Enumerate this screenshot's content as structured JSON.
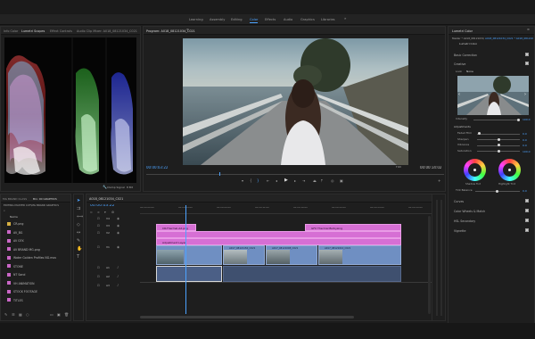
{
  "workspaces": [
    {
      "label": "Learning",
      "active": false
    },
    {
      "label": "Assembly",
      "active": false
    },
    {
      "label": "Editing",
      "active": false
    },
    {
      "label": "Color",
      "active": true
    },
    {
      "label": "Effects",
      "active": false
    },
    {
      "label": "Audio",
      "active": false
    },
    {
      "label": "Graphics",
      "active": false
    },
    {
      "label": "Libraries",
      "active": false
    }
  ],
  "left_panel": {
    "tabs": [
      "Info Color",
      "Lumetri Scopes",
      "Effect Controls",
      "Audio Clip Mixer: A018_08121034_C021"
    ],
    "active_tab": "Lumetri Scopes",
    "clamp_label": "Clamp Signal",
    "bit_label": "8 Bit"
  },
  "program_monitor": {
    "title": "Program: A018_08121034_C021",
    "timecode_left": "00:00:03:22",
    "fit_label": "Full",
    "timecode_right": "00:00:14:02"
  },
  "project_panel": {
    "tabs": [
      "MG BRAND CLASS",
      "Bin: 00 GRAPHICS"
    ],
    "subtitle": "EDITING MASTER CUT\\MG BRAND GRAPHICS",
    "header": "Name",
    "items": [
      {
        "name": "CR.png",
        "color": "#d6b043"
      },
      {
        "name": "AV_BG",
        "color": "#c966c6"
      },
      {
        "name": "AV GFX",
        "color": "#c966c6"
      },
      {
        "name": "AV BRAND MG.png",
        "color": "#c966c6"
      },
      {
        "name": "Water Golden Profiles NG.mov",
        "color": "#c966c6"
      },
      {
        "name": "STONE",
        "color": "#c966c6"
      },
      {
        "name": "NT Sand",
        "color": "#c966c6"
      },
      {
        "name": "VH ANIMATION",
        "color": "#c966c6"
      },
      {
        "name": "STOCK FOOTAGE",
        "color": "#c966c6"
      },
      {
        "name": "TITLES",
        "color": "#c966c6"
      }
    ]
  },
  "timeline": {
    "tab": "A018_08121034_C021",
    "timecode": "00:00:03:22",
    "ruler": [
      "00:00:00:00",
      "00:00:04:00",
      "00:00:08:00",
      "00:00:12:00",
      "00:00:16:00",
      "00:00:20:00",
      "00:00:24:00",
      "00:00:28:00"
    ],
    "tracks": [
      "V4",
      "V3",
      "V2",
      "V1",
      "A1",
      "A2",
      "A3"
    ],
    "clips": {
      "graphic_a": "CR-Thermal-Ad.png",
      "graphic_b": "GFX Thermal Bulbysing",
      "adjustment": "Adjustment Layer",
      "v1": [
        "A018_08121034_C021",
        "A017_08121150_C021",
        "A017_08121008_C021",
        "A017_08121010_C021"
      ]
    }
  },
  "lumetri": {
    "tabs": [
      "Lumetri Color"
    ],
    "master": "Master * A018_08121034_C021",
    "clip_path": "A018_08121034_C021 * A018_08121034_C021",
    "effect": "Lumetri Color",
    "sections": {
      "basic": "Basic Correction",
      "creative": "Creative",
      "curves": "Curves",
      "wheels": "Color Wheels & Match",
      "hsl": "HSL Secondary",
      "vignette": "Vignette"
    },
    "look_label": "Look",
    "look_value": "None",
    "intensity_label": "Intensity",
    "intensity_value": "100.0",
    "adjustments_label": "Adjustments",
    "sliders": [
      {
        "label": "Faded Film",
        "value": "0.0",
        "pos": 0.06
      },
      {
        "label": "Sharpen",
        "value": "0.0",
        "pos": 0.5
      },
      {
        "label": "Vibrance",
        "value": "0.0",
        "pos": 0.5
      },
      {
        "label": "Saturation",
        "value": "100.0",
        "pos": 0.5
      }
    ],
    "shadow_tint": "Shadow Tint",
    "highlight_tint": "Highlight Tint",
    "tint_balance": "Tint Balance",
    "tint_balance_value": "0.0"
  },
  "colors": {
    "accent": "#4da3ff",
    "playhead": "#4da3ff",
    "graphic_clip": "#d66fd4",
    "video_clip": "#6f8fc2"
  }
}
